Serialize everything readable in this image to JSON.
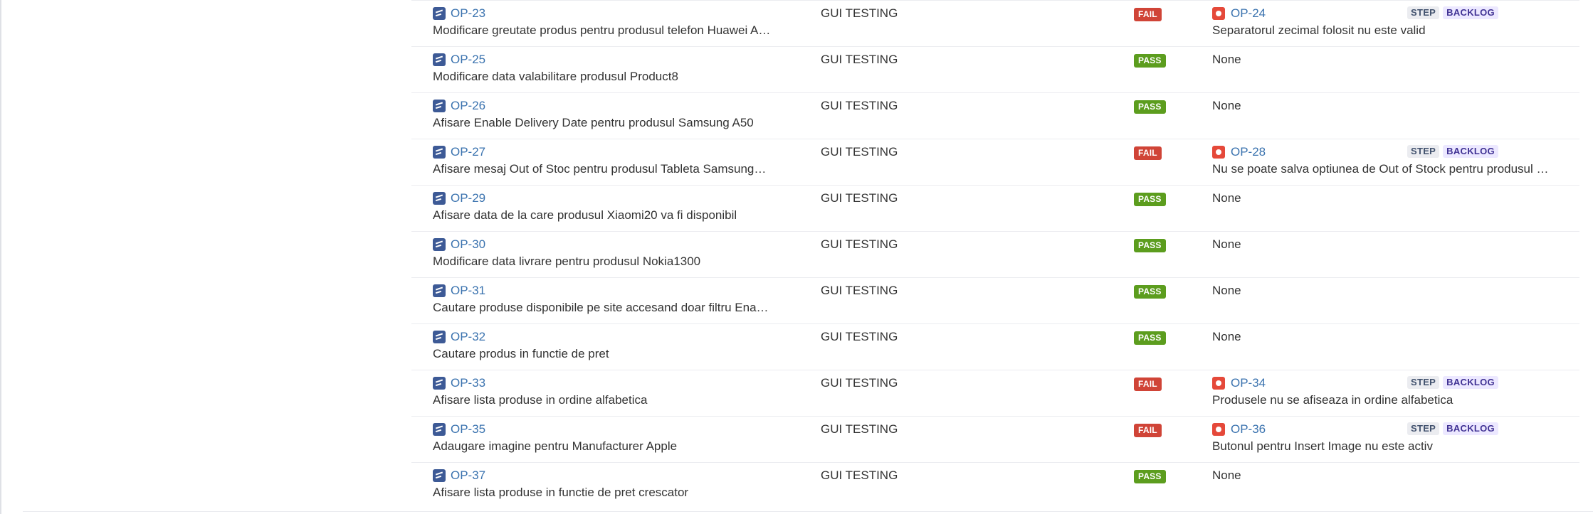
{
  "rows": [
    {
      "key": "OP-23",
      "summary": "Modificare greutate produs pentru produsul telefon Huawei A…",
      "environment": "GUI TESTING",
      "status": "FAIL",
      "defect": {
        "key": "OP-24",
        "summary": "Separatorul zecimal folosit nu este valid",
        "step": "STEP",
        "backlog": "BACKLOG"
      }
    },
    {
      "key": "OP-25",
      "summary": "Modificare data valabilitare produsul Product8",
      "environment": "GUI TESTING",
      "status": "PASS",
      "defect_text": "None"
    },
    {
      "key": "OP-26",
      "summary": "Afisare Enable Delivery Date pentru produsul Samsung A50",
      "environment": "GUI TESTING",
      "status": "PASS",
      "defect_text": "None"
    },
    {
      "key": "OP-27",
      "summary": "Afisare mesaj Out of Stoc pentru produsul Tableta Samsung…",
      "environment": "GUI TESTING",
      "status": "FAIL",
      "defect": {
        "key": "OP-28",
        "summary": "Nu se poate salva optiunea de Out of Stock pentru produsul …",
        "step": "STEP",
        "backlog": "BACKLOG"
      }
    },
    {
      "key": "OP-29",
      "summary": "Afisare data de la care produsul Xiaomi20 va fi disponibil",
      "environment": "GUI TESTING",
      "status": "PASS",
      "defect_text": "None"
    },
    {
      "key": "OP-30",
      "summary": "Modificare data livrare pentru produsul Nokia1300",
      "environment": "GUI TESTING",
      "status": "PASS",
      "defect_text": "None"
    },
    {
      "key": "OP-31",
      "summary": "Cautare produse disponibile pe site accesand doar filtru Ena…",
      "environment": "GUI TESTING",
      "status": "PASS",
      "defect_text": "None"
    },
    {
      "key": "OP-32",
      "summary": "Cautare produs in functie de pret",
      "environment": "GUI TESTING",
      "status": "PASS",
      "defect_text": "None"
    },
    {
      "key": "OP-33",
      "summary": "Afisare lista produse in ordine alfabetica",
      "environment": "GUI TESTING",
      "status": "FAIL",
      "defect": {
        "key": "OP-34",
        "summary": "Produsele nu se afiseaza in ordine alfabetica",
        "step": "STEP",
        "backlog": "BACKLOG"
      }
    },
    {
      "key": "OP-35",
      "summary": "Adaugare imagine pentru Manufacturer Apple",
      "environment": "GUI TESTING",
      "status": "FAIL",
      "defect": {
        "key": "OP-36",
        "summary": "Butonul pentru Insert Image nu este activ",
        "step": "STEP",
        "backlog": "BACKLOG"
      }
    },
    {
      "key": "OP-37",
      "summary": "Afisare lista produse in functie de pret crescator",
      "environment": "GUI TESTING",
      "status": "PASS",
      "defect_text": "None"
    }
  ],
  "icons": {
    "test": "test-icon",
    "bug": "bug-icon"
  },
  "colors": {
    "link": "#3b73af",
    "fail": "#d04437",
    "pass": "#5c9d1e",
    "bug": "#e5493a",
    "test_icon": "#3d5a96"
  }
}
